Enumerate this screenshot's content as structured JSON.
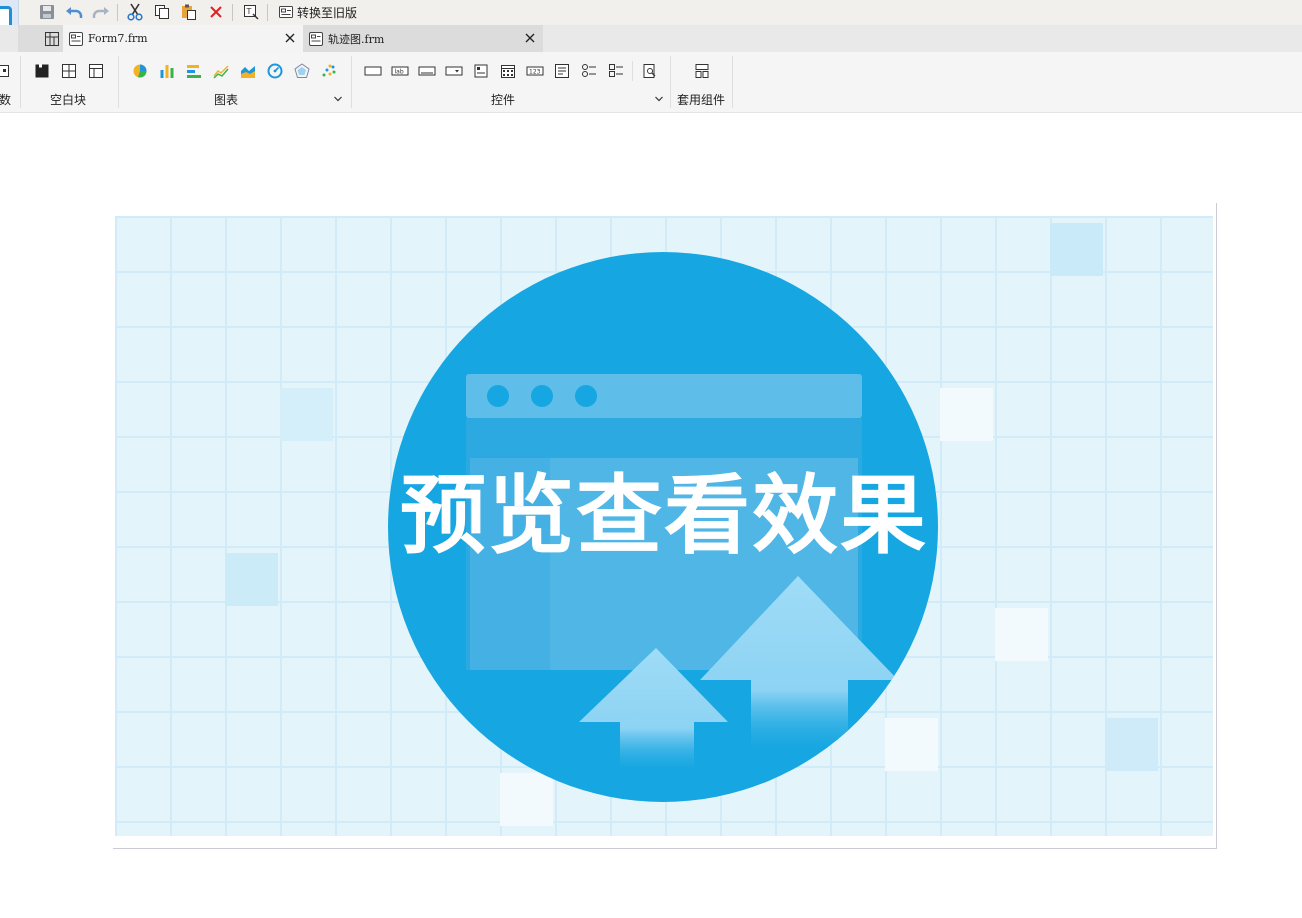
{
  "quickbar": {
    "convert_label": "转换至旧版"
  },
  "tabs": [
    {
      "label": "Form7.frm",
      "active": true
    },
    {
      "label": "轨迹图.frm",
      "active": false
    }
  ],
  "ribbon": {
    "groups": {
      "params": "数",
      "blank_block": "空白块",
      "chart": "图表",
      "controls": "控件",
      "templates": "套用组件"
    }
  },
  "preview": {
    "title": "预览查看效果"
  },
  "colors": {
    "accent": "#1f8fd6",
    "preview_blue": "#16a6e1",
    "preview_bg": "#e4f4fb",
    "close_red": "#e02424"
  }
}
